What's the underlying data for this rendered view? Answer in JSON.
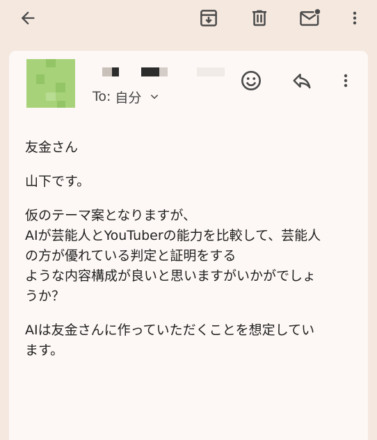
{
  "toolbar": {
    "back_icon": "arrow-back-icon",
    "archive_icon": "archive-icon",
    "delete_icon": "trash-icon",
    "mark_unread_icon": "mail-unread-icon",
    "more_icon": "more-vert-icon"
  },
  "message": {
    "sender_name": "",
    "recipient_prefix": "To:",
    "recipient_name": "自分",
    "emoji_icon": "smiley-icon",
    "reply_icon": "reply-icon",
    "more_icon": "more-vert-icon",
    "body": [
      "友金さん",
      "山下です。",
      "仮のテーマ案となりますが、\nAIが芸能人とYouTuberの能力を比較して、芸能人\nの方が優れている判定と証明をする\nような内容構成が良いと思いますがいかがでしょ\nうか？",
      "AIは友金さんに作っていただくことを想定してい\nます。"
    ]
  },
  "colors": {
    "background": "#f4e8df",
    "card": "#fdf8f5",
    "icon": "#4a4a4a",
    "avatar": "#a7d27a"
  }
}
